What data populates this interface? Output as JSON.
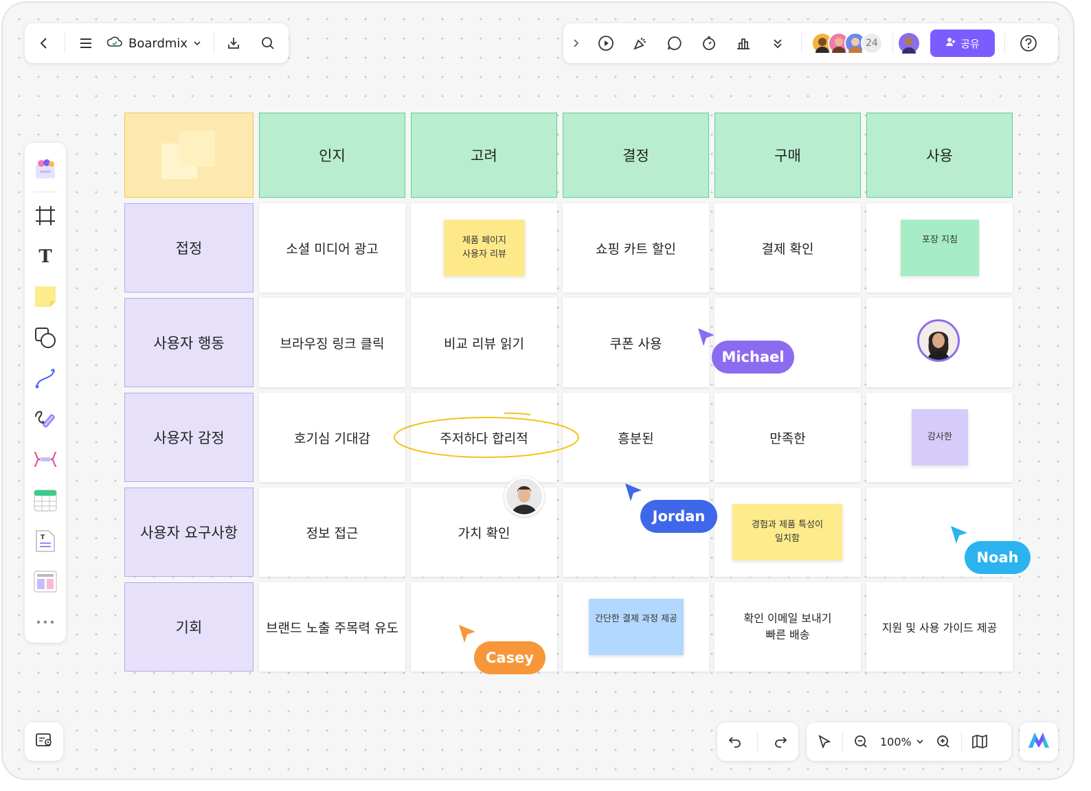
{
  "toolbar_left": {
    "back_icon": "chevron-left-icon",
    "menu_icon": "hamburger-icon",
    "cloud_icon": "cloud-icon",
    "app_name": "Boardmix",
    "app_dropdown_icon": "chevron-down-icon",
    "download_icon": "download-icon",
    "search_icon": "search-icon"
  },
  "toolbar_right": {
    "tools": [
      "chevron-right-icon",
      "play-icon",
      "celebrate-icon",
      "comment-icon",
      "timer-icon",
      "vote-icon",
      "more-down-icon"
    ],
    "collaborator_count": "24",
    "share_label": "공유",
    "help_icon": "help-icon"
  },
  "sidebar": {
    "items": [
      "templates-icon",
      "frame-icon",
      "text-icon",
      "sticky-note-icon",
      "shape-icon",
      "connector-icon",
      "pen-icon",
      "mindmap-icon",
      "table-icon",
      "document-icon",
      "layout-icon",
      "more-icon"
    ]
  },
  "board": {
    "columns": [
      "인지",
      "고려",
      "결정",
      "구매",
      "사용"
    ],
    "rows": [
      {
        "label": "접정",
        "cells": [
          "소셜 미디어 광고",
          "",
          "쇼핑 카트 할인",
          "결제 확인",
          ""
        ]
      },
      {
        "label": "사용자 행동",
        "cells": [
          "브라우징 링크 클릭",
          "비교 리뷰 읽기",
          "쿠폰 사용",
          "",
          ""
        ]
      },
      {
        "label": "사용자 감정",
        "cells": [
          "호기심 기대감",
          "주저하다 합리적",
          "흥분된",
          "만족한",
          ""
        ]
      },
      {
        "label": "사용자 요구사항",
        "cells": [
          "정보 접근",
          "가치 확인",
          "",
          "",
          ""
        ]
      },
      {
        "label": "기회",
        "cells": [
          "브랜드 노출 주목력 유도",
          "",
          "",
          "확인 이메일 보내기\n빠른 배송",
          "지원 및 사용 가이드 제공"
        ]
      }
    ]
  },
  "stickies": {
    "product_page": {
      "line1": "제품 페이지",
      "line2": "사용자 리뷰",
      "color": "#fde98a"
    },
    "packaging": {
      "text": "포장 지침",
      "color": "#a6ecc4"
    },
    "grateful": {
      "text": "감사한",
      "color": "#d6ccfa"
    },
    "experience": {
      "line1": "경험과 제품 특성이",
      "line2": "일치함",
      "color": "#fdeb8c"
    },
    "checkout": {
      "text": "간단한 결제 과정 제공",
      "color": "#b3d8ff"
    }
  },
  "cursors": [
    {
      "name": "Michael",
      "color": "#8b6cf0"
    },
    {
      "name": "Jordan",
      "color": "#3f67ea"
    },
    {
      "name": "Noah",
      "color": "#2bb3f0"
    },
    {
      "name": "Casey",
      "color": "#f7973a"
    }
  ],
  "bottom": {
    "map_icon": "map-location-icon",
    "undo_icon": "undo-icon",
    "redo_icon": "redo-icon",
    "select_icon": "pointer-icon",
    "zoom_out_icon": "zoom-out-icon",
    "zoom_level": "100%",
    "zoom_in_icon": "zoom-in-icon",
    "minimap_icon": "book-map-icon",
    "ai_icon": "boardmix-logo-icon"
  }
}
